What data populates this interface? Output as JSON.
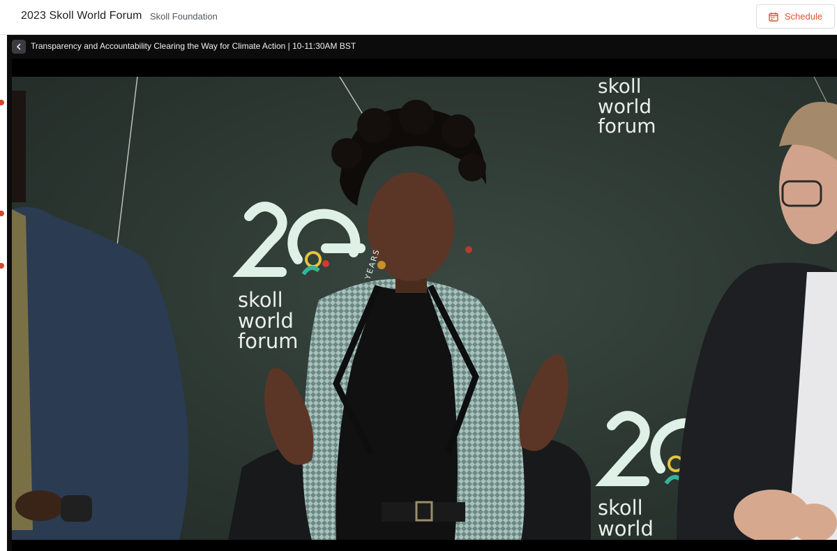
{
  "header": {
    "event_title": "2023 Skoll World Forum",
    "organizer": "Skoll Foundation",
    "schedule_label": "Schedule",
    "schedule_icon": "calendar-icon"
  },
  "player": {
    "back_icon": "chevron-left-icon",
    "session_title": "Transparency and Accountability Clearing the Way for Climate Action | 10-11:30AM BST"
  },
  "video": {
    "backdrop_logo_lines": [
      "skoll",
      "world",
      "forum"
    ],
    "backdrop_years": "YEARS"
  },
  "colors": {
    "accent": "#e0512a",
    "player_bg": "#0c0c0d",
    "backdrop": "#2f3a35"
  }
}
